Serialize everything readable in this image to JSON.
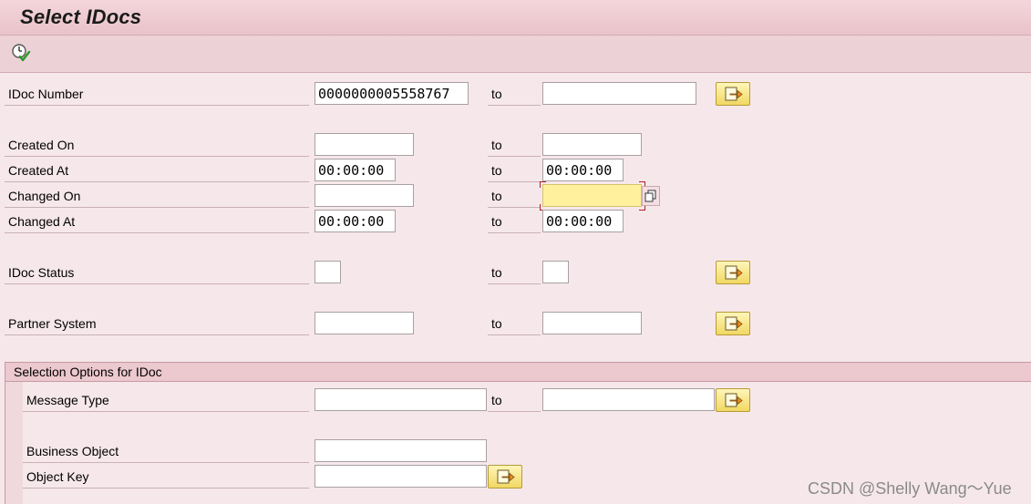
{
  "title": "Select IDocs",
  "toolbar": {
    "execute_icon": "execute-clock-check-icon"
  },
  "range_label": "to",
  "fields": {
    "idoc_number": {
      "label": "IDoc Number",
      "from": "0000000005558767",
      "to": ""
    },
    "created_on": {
      "label": "Created On",
      "from": "",
      "to": ""
    },
    "created_at": {
      "label": "Created At",
      "from": "00:00:00",
      "to": "00:00:00"
    },
    "changed_on": {
      "label": "Changed On",
      "from": "",
      "to": ""
    },
    "changed_at": {
      "label": "Changed At",
      "from": "00:00:00",
      "to": "00:00:00"
    },
    "idoc_status": {
      "label": "IDoc Status",
      "from": "",
      "to": ""
    },
    "partner_system": {
      "label": "Partner System",
      "from": "",
      "to": ""
    }
  },
  "selection_options": {
    "title": "Selection Options for IDoc",
    "message_type": {
      "label": "Message Type",
      "from": "",
      "to": ""
    },
    "business_object": {
      "label": "Business Object",
      "value": ""
    },
    "object_key": {
      "label": "Object Key",
      "value": ""
    }
  },
  "icons": {
    "multiple_selection": "multiple-selection-arrow-icon",
    "value_help": "value-help-icon"
  },
  "colors": {
    "background": "#f6e8ea",
    "title_bar": "#e8c3ca",
    "focused_field": "#fff09e",
    "button_yellow": "#f1d862"
  },
  "watermark": "CSDN @Shelly Wang～Yue"
}
